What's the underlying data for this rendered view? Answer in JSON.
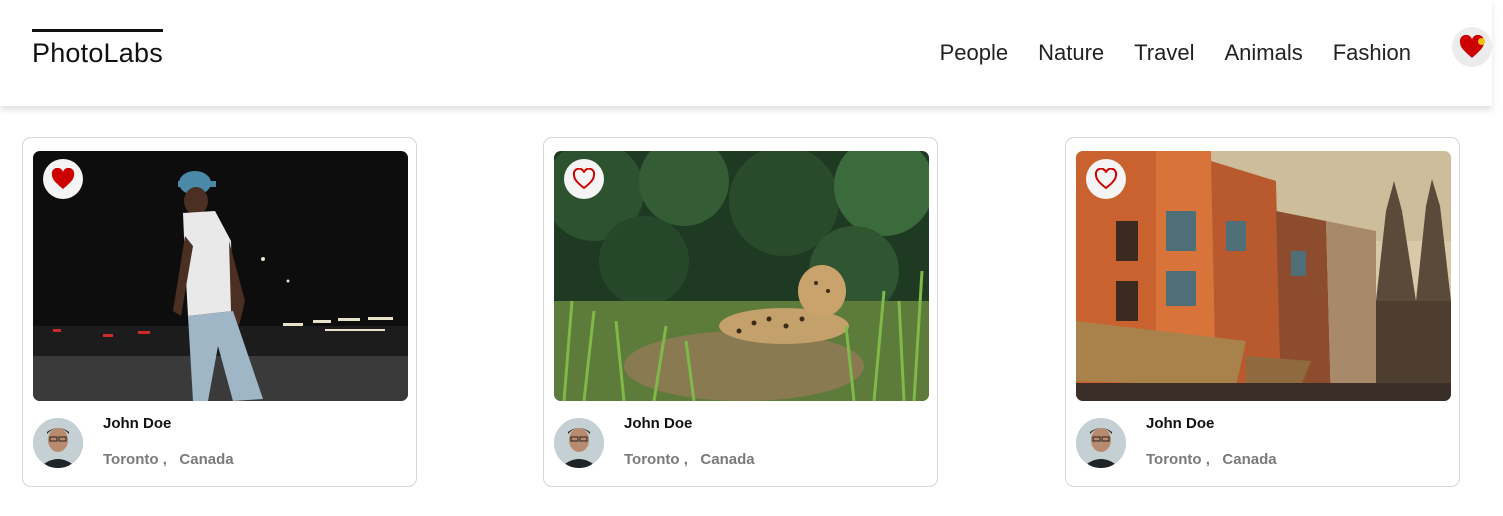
{
  "app": {
    "logo": "PhotoLabs"
  },
  "nav": {
    "items": [
      "People",
      "Nature",
      "Travel",
      "Animals",
      "Fashion"
    ]
  },
  "favorites": {
    "icon": "heart-icon",
    "has_notification": true,
    "notification_color": "#f2c200"
  },
  "colors": {
    "heart_red": "#cc0000",
    "location_gray": "#7a7a7a",
    "card_border": "#d6d6d6"
  },
  "photos": [
    {
      "liked": true,
      "user": {
        "name": "John Doe",
        "city": "Toronto",
        "separator": ",",
        "country": "Canada"
      }
    },
    {
      "liked": false,
      "user": {
        "name": "John Doe",
        "city": "Toronto",
        "separator": ",",
        "country": "Canada"
      }
    },
    {
      "liked": false,
      "user": {
        "name": "John Doe",
        "city": "Toronto",
        "separator": ",",
        "country": "Canada"
      }
    }
  ]
}
